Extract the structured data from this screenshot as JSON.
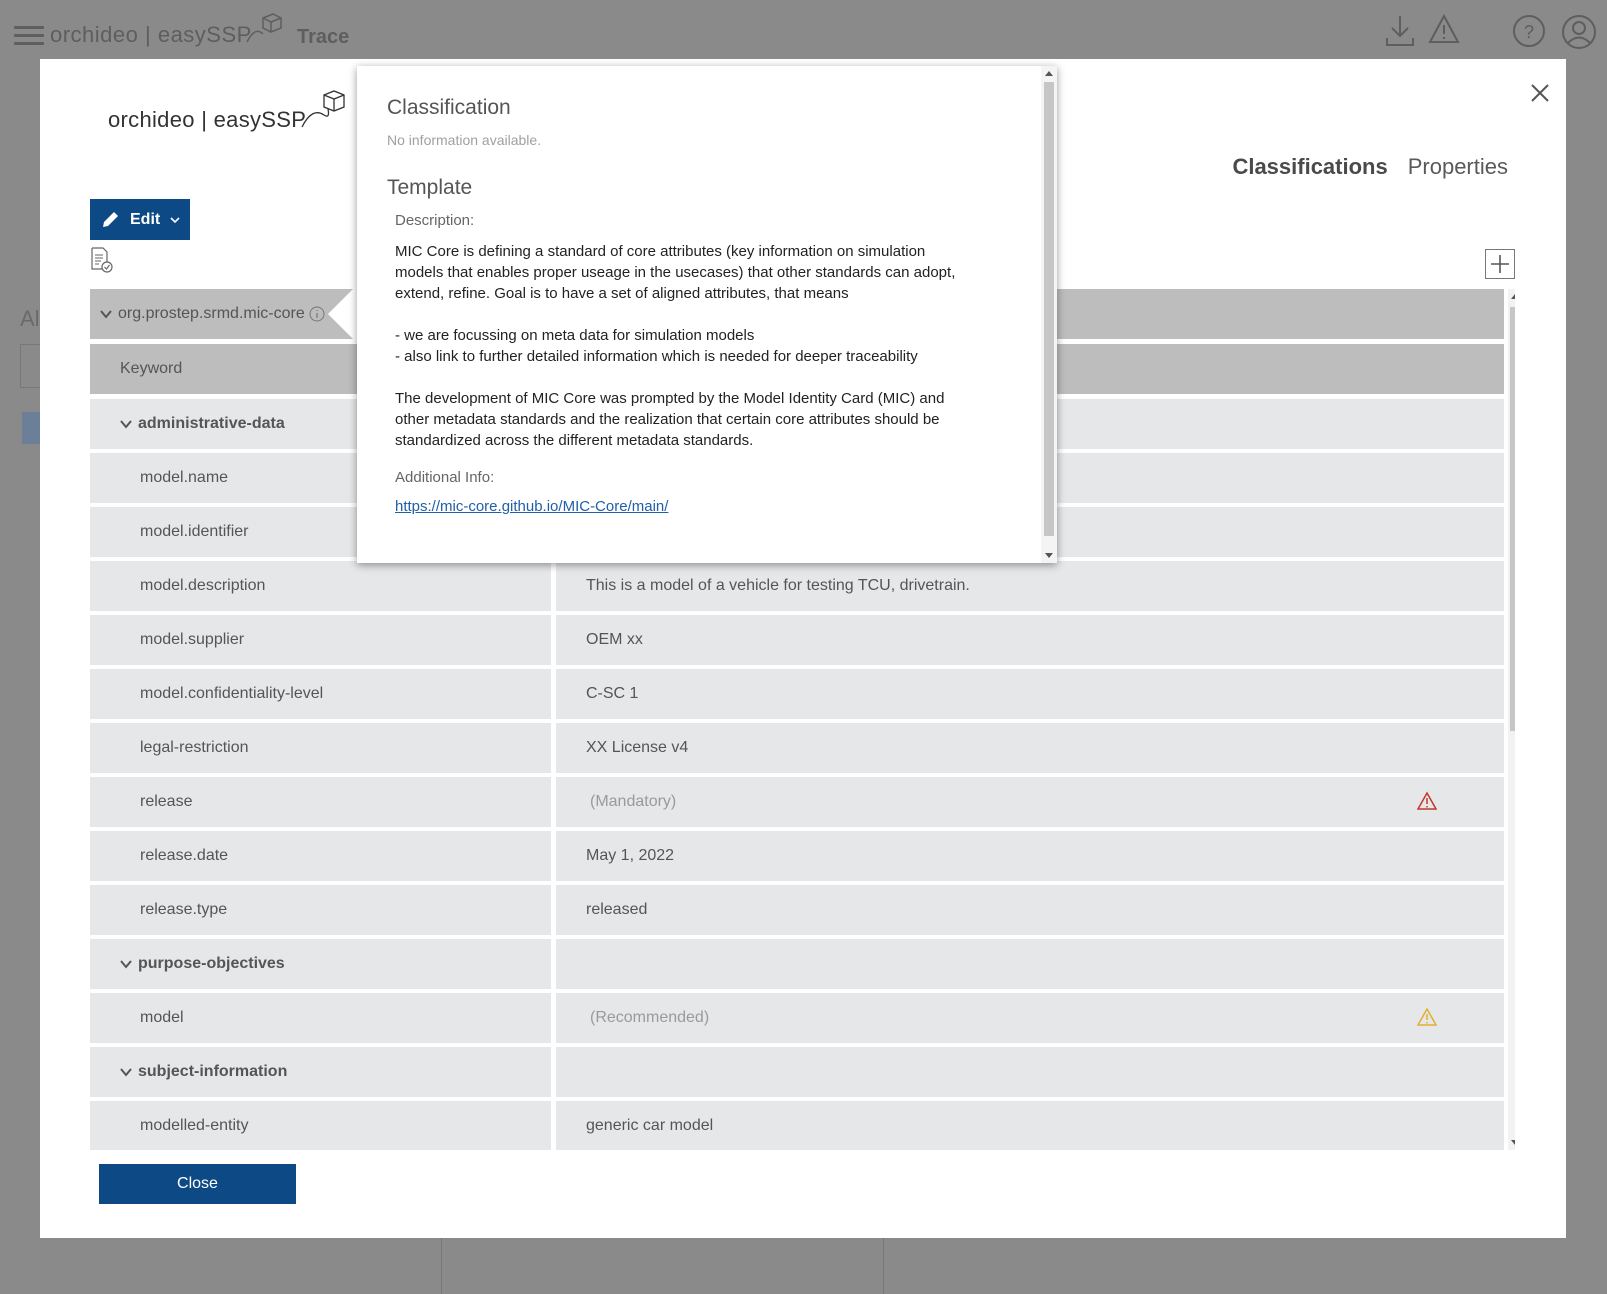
{
  "app": {
    "logo_text": "orchideo | easySSP",
    "section": "Trace",
    "side_text": "Al"
  },
  "modal": {
    "logo_text": "orchideo | easySSP",
    "tabs": [
      {
        "label": "Classifications",
        "active": true
      },
      {
        "label": "Properties",
        "active": false
      }
    ],
    "edit_label": "Edit",
    "close_label": "Close"
  },
  "table": {
    "classification": "org.prostep.srmd.mic-core",
    "header_label": "Keyword",
    "rows": [
      {
        "type": "group",
        "key": "administrative-data",
        "value": ""
      },
      {
        "type": "item",
        "key": "model.name",
        "value": ""
      },
      {
        "type": "item",
        "key": "model.identifier",
        "value": ""
      },
      {
        "type": "item",
        "key": "model.description",
        "value": "This is a model of a vehicle for testing TCU, drivetrain."
      },
      {
        "type": "item",
        "key": "model.supplier",
        "value": "OEM xx"
      },
      {
        "type": "item",
        "key": "model.confidentiality-level",
        "value": "C-SC 1"
      },
      {
        "type": "item",
        "key": "legal-restriction",
        "value": "XX License v4"
      },
      {
        "type": "item",
        "key": "release",
        "value": "(Mandatory)",
        "placeholder": true,
        "warning": "error"
      },
      {
        "type": "item",
        "key": "release.date",
        "value": "May 1, 2022"
      },
      {
        "type": "item",
        "key": "release.type",
        "value": "released"
      },
      {
        "type": "group",
        "key": "purpose-objectives",
        "value": ""
      },
      {
        "type": "item",
        "key": "model",
        "value": "(Recommended)",
        "placeholder": true,
        "warning": "warning"
      },
      {
        "type": "group",
        "key": "subject-information",
        "value": ""
      },
      {
        "type": "item",
        "key": "modelled-entity",
        "value": "generic car model"
      }
    ]
  },
  "popover": {
    "classification_heading": "Classification",
    "no_info": "No information available.",
    "template_heading": "Template",
    "description_label": "Description:",
    "description_lines": [
      "MIC Core is defining a standard of core attributes (key information on simulation",
      "models that enables proper useage in the usecases) that other standards can adopt,",
      "extend, refine. Goal is to have a set of aligned attributes, that means",
      "",
      "- we are focussing on meta data for simulation models",
      "- also link to further detailed information which is needed for deeper traceability",
      "",
      "The development of MIC Core was prompted by the Model Identity Card (MIC) and",
      "other metadata standards and the realization that certain core attributes should be",
      "standardized across the different metadata standards."
    ],
    "additional_info_label": "Additional Info:",
    "link": "https://mic-core.github.io/MIC-Core/main/"
  },
  "colors": {
    "primary": "#0d4a85",
    "error": "#c0392b",
    "warning": "#e0b030"
  }
}
